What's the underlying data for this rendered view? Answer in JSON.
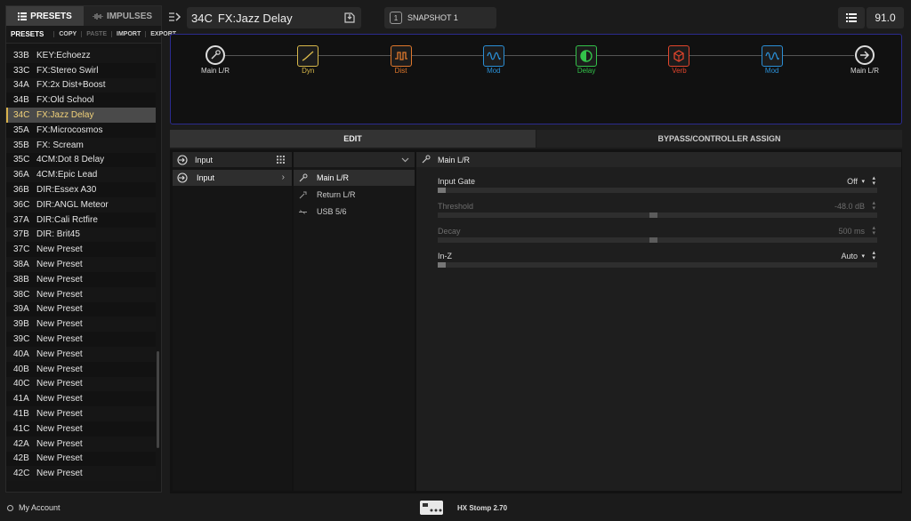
{
  "left_panel": {
    "tabs": [
      {
        "label": "PRESETS",
        "icon": "list-icon",
        "active": true
      },
      {
        "label": "IMPULSES",
        "icon": "waveform-icon",
        "active": false
      }
    ],
    "toolbar": {
      "title": "PRESETS",
      "actions": [
        {
          "label": "COPY",
          "enabled": true
        },
        {
          "label": "PASTE",
          "enabled": false
        },
        {
          "label": "IMPORT",
          "enabled": true
        },
        {
          "label": "EXPORT",
          "enabled": true
        }
      ]
    },
    "presets": [
      {
        "id": "33B",
        "name": "KEY:Echoezz"
      },
      {
        "id": "33C",
        "name": "FX:Stereo Swirl"
      },
      {
        "id": "34A",
        "name": "FX:2x Dist+Boost"
      },
      {
        "id": "34B",
        "name": "FX:Old School"
      },
      {
        "id": "34C",
        "name": "FX:Jazz Delay",
        "selected": true
      },
      {
        "id": "35A",
        "name": "FX:Microcosmos"
      },
      {
        "id": "35B",
        "name": "FX: Scream"
      },
      {
        "id": "35C",
        "name": "4CM:Dot 8 Delay"
      },
      {
        "id": "36A",
        "name": "4CM:Epic Lead"
      },
      {
        "id": "36B",
        "name": "DIR:Essex A30"
      },
      {
        "id": "36C",
        "name": "DIR:ANGL Meteor"
      },
      {
        "id": "37A",
        "name": "DIR:Cali Rctfire"
      },
      {
        "id": "37B",
        "name": "DIR: Brit45"
      },
      {
        "id": "37C",
        "name": "New Preset"
      },
      {
        "id": "38A",
        "name": "New Preset"
      },
      {
        "id": "38B",
        "name": "New Preset"
      },
      {
        "id": "38C",
        "name": "New Preset"
      },
      {
        "id": "39A",
        "name": "New Preset"
      },
      {
        "id": "39B",
        "name": "New Preset"
      },
      {
        "id": "39C",
        "name": "New Preset"
      },
      {
        "id": "40A",
        "name": "New Preset"
      },
      {
        "id": "40B",
        "name": "New Preset"
      },
      {
        "id": "40C",
        "name": "New Preset"
      },
      {
        "id": "41A",
        "name": "New Preset"
      },
      {
        "id": "41B",
        "name": "New Preset"
      },
      {
        "id": "41C",
        "name": "New Preset"
      },
      {
        "id": "42A",
        "name": "New Preset"
      },
      {
        "id": "42B",
        "name": "New Preset"
      },
      {
        "id": "42C",
        "name": "New Preset"
      }
    ],
    "scroll_position": 0.88,
    "scroll_visible_fraction": 0.22
  },
  "header": {
    "preset_id": "34C",
    "preset_name": "FX:Jazz Delay",
    "snapshot_number": "1",
    "snapshot_label": "SNAPSHOT 1",
    "tempo": "91.0"
  },
  "chain": {
    "blocks": [
      {
        "label": "Main L/R",
        "kind": "input",
        "color": "#d8d8d8",
        "icon": "input-jack-icon"
      },
      {
        "label": "Dyn",
        "kind": "block",
        "color": "#d8b84a",
        "icon": "dynamics-icon"
      },
      {
        "label": "Dist",
        "kind": "block",
        "color": "#e0782c",
        "icon": "distortion-icon"
      },
      {
        "label": "Mod",
        "kind": "block",
        "color": "#2a8fd6",
        "icon": "modulation-icon"
      },
      {
        "label": "Delay",
        "kind": "block",
        "color": "#33c24a",
        "icon": "delay-icon"
      },
      {
        "label": "Verb",
        "kind": "block",
        "color": "#e2452c",
        "icon": "reverb-icon"
      },
      {
        "label": "Mod",
        "kind": "block",
        "color": "#2a8fd6",
        "icon": "modulation-icon"
      },
      {
        "label": "Main L/R",
        "kind": "output",
        "color": "#d8d8d8",
        "icon": "output-arrow-icon"
      }
    ]
  },
  "edit_tabs": {
    "edit": "EDIT",
    "bypass": "BYPASS/CONTROLLER ASSIGN"
  },
  "model_column": {
    "header": "Input",
    "items": [
      {
        "label": "Input",
        "selected": true
      }
    ]
  },
  "sub_column": {
    "items": [
      {
        "label": "Main L/R",
        "selected": true,
        "icon": "guitar-jack-icon"
      },
      {
        "label": "Return L/R",
        "selected": false,
        "icon": "return-jack-icon"
      },
      {
        "label": "USB 5/6",
        "selected": false,
        "icon": "usb-icon"
      }
    ]
  },
  "params": {
    "header": "Main L/R",
    "items": [
      {
        "name": "Input Gate",
        "value": "Off",
        "position": 0.0,
        "enabled": true,
        "dropdown": true
      },
      {
        "name": "Threshold",
        "value": "-48.0 dB",
        "position": 0.49,
        "enabled": false,
        "dropdown": false
      },
      {
        "name": "Decay",
        "value": "500 ms",
        "position": 0.49,
        "enabled": false,
        "dropdown": false
      },
      {
        "name": "In-Z",
        "value": "Auto",
        "position": 0.0,
        "enabled": true,
        "dropdown": true
      }
    ]
  },
  "footer": {
    "account": "My Account",
    "device": "HX Stomp 2.70"
  }
}
